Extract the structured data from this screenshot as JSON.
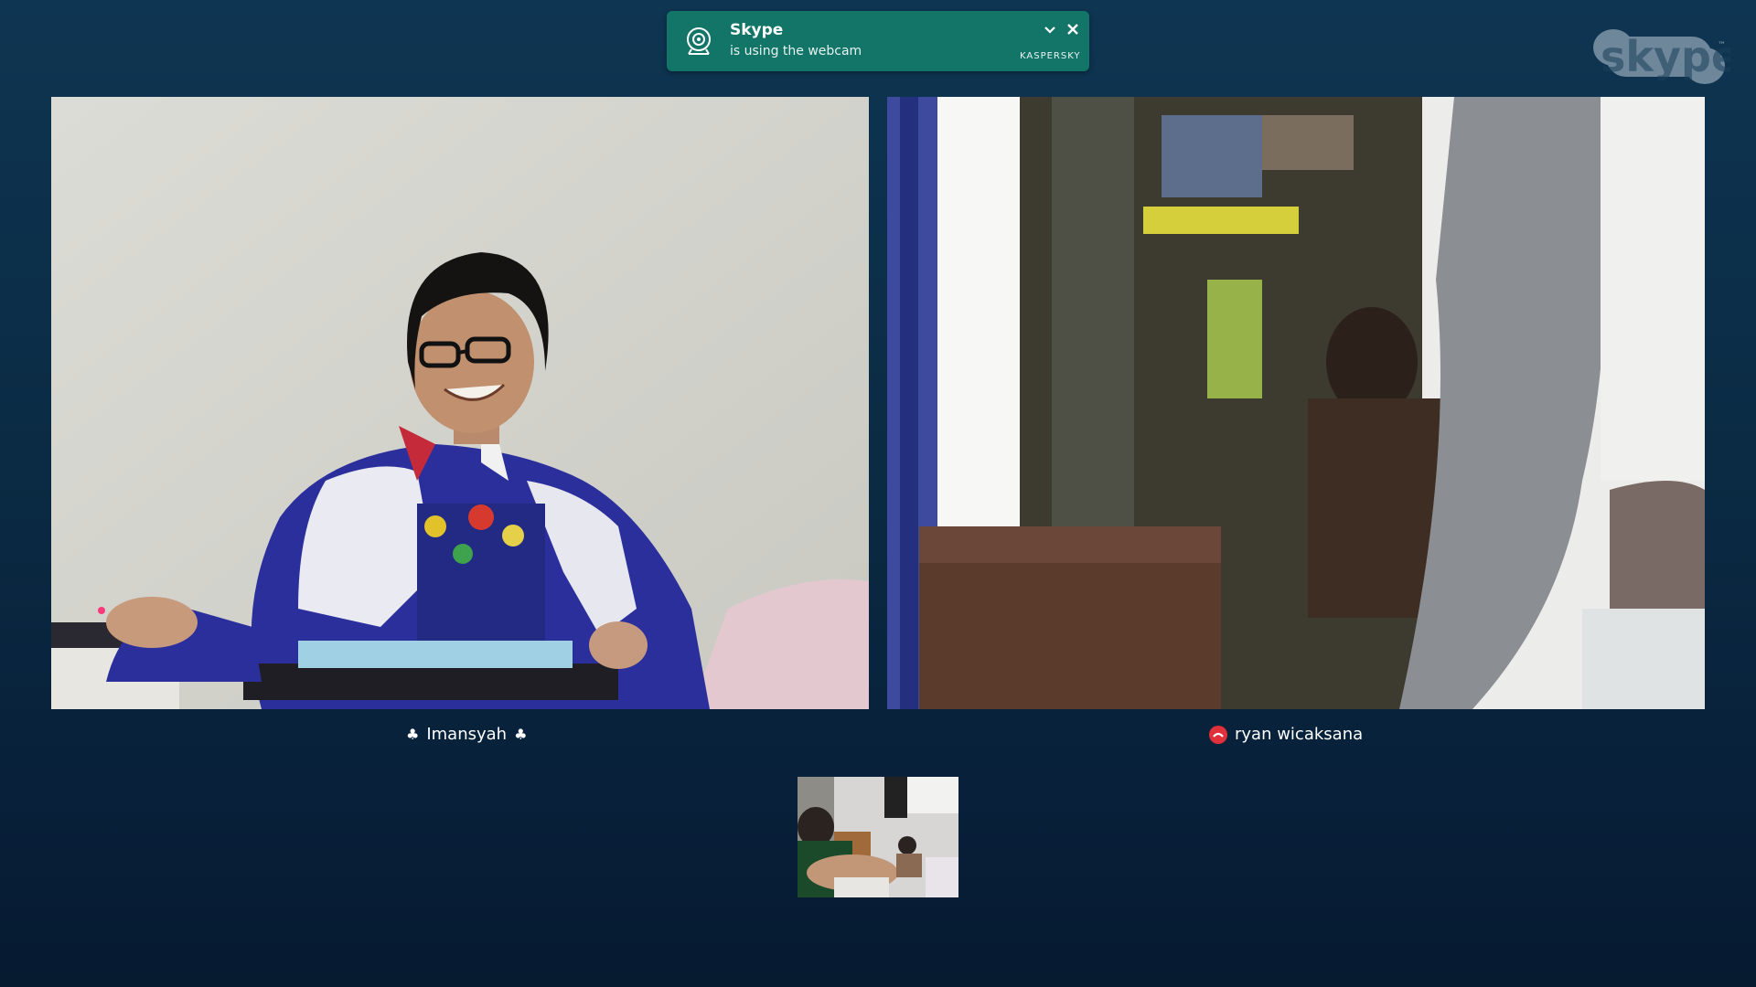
{
  "notification": {
    "app_name": "Skype",
    "message": "is using the webcam",
    "vendor": "KASPERSKY",
    "background": "#137468"
  },
  "logo": {
    "text": "skype",
    "mark": "™"
  },
  "participants": [
    {
      "name": "Imansyah",
      "decoration_icon": "club-icon"
    },
    {
      "name": "ryan wicaksana",
      "status_icon": "hangup-icon"
    }
  ],
  "self_view": {
    "label": ""
  },
  "colors": {
    "background": "#0b2b44",
    "accent": "#137468",
    "hangup": "#e0303a"
  }
}
